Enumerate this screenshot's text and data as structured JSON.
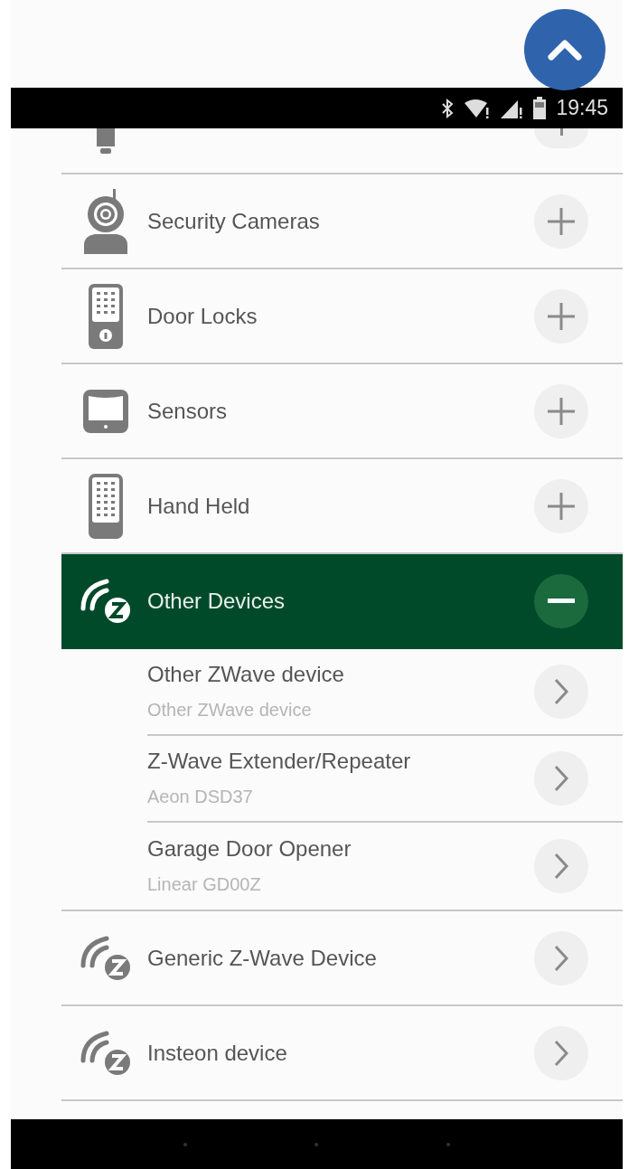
{
  "status_bar": {
    "time": "19:45"
  },
  "categories": [
    {
      "label": "Security Cameras",
      "kind": "camera",
      "expandable": true,
      "expanded": false
    },
    {
      "label": "Door Locks",
      "kind": "lock",
      "expandable": true,
      "expanded": false
    },
    {
      "label": "Sensors",
      "kind": "sensor",
      "expandable": true,
      "expanded": false
    },
    {
      "label": "Hand Held",
      "kind": "handheld",
      "expandable": true,
      "expanded": false
    },
    {
      "label": "Other Devices",
      "kind": "zwave",
      "expandable": true,
      "expanded": true,
      "children": [
        {
          "title": "Other ZWave device",
          "subtitle": "Other ZWave device"
        },
        {
          "title": "Z-Wave Extender/Repeater",
          "subtitle": "Aeon DSD37"
        },
        {
          "title": "Garage Door Opener",
          "subtitle": "Linear GD00Z"
        }
      ]
    },
    {
      "label": "Generic Z-Wave Device",
      "kind": "zwave",
      "expandable": false
    },
    {
      "label": "Insteon device",
      "kind": "zwave",
      "expandable": false
    }
  ]
}
